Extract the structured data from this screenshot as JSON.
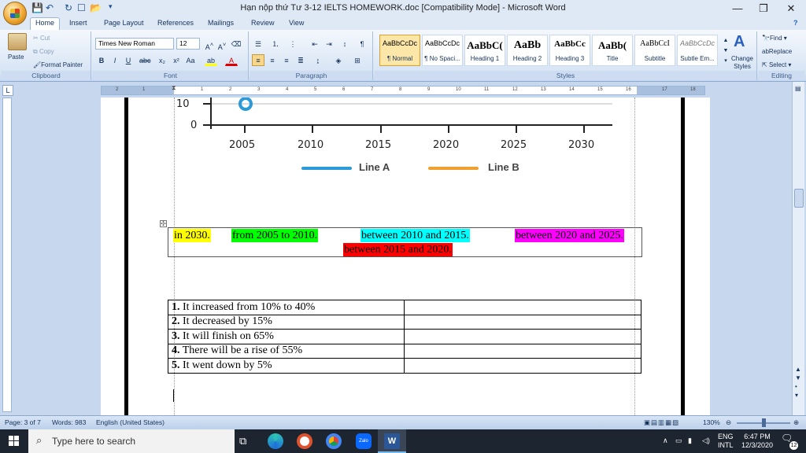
{
  "window": {
    "title": "Hạn nộp thứ Tư 3-12 IELTS HOMEWORK.doc [Compatibility Mode] - Microsoft Word",
    "minimize": "—",
    "restore": "❐",
    "close": "✕",
    "help": "?"
  },
  "tabs": [
    "Home",
    "Insert",
    "Page Layout",
    "References",
    "Mailings",
    "Review",
    "View"
  ],
  "ribbon": {
    "clipboard": {
      "label": "Clipboard",
      "paste": "Paste",
      "cut": "Cut",
      "copy": "Copy",
      "format_painter": "Format Painter"
    },
    "font": {
      "label": "Font",
      "name": "Times New Roman",
      "size": "12"
    },
    "paragraph": {
      "label": "Paragraph"
    },
    "styles": {
      "label": "Styles",
      "items": [
        {
          "sample": "AaBbCcDc",
          "name": "¶ Normal"
        },
        {
          "sample": "AaBbCcDc",
          "name": "¶ No Spaci..."
        },
        {
          "sample": "AaBbC(",
          "name": "Heading 1"
        },
        {
          "sample": "AaBb",
          "name": "Heading 2"
        },
        {
          "sample": "AaBbCc",
          "name": "Heading 3"
        },
        {
          "sample": "AaBb(",
          "name": "Title"
        },
        {
          "sample": "AaBbCcI",
          "name": "Subtitle"
        },
        {
          "sample": "AaBbCcDc",
          "name": "Subtle Em..."
        }
      ],
      "change_styles": "Change Styles"
    },
    "editing": {
      "label": "Editing",
      "find": "Find",
      "replace": "Replace",
      "select": "Select"
    }
  },
  "ruler": [
    "2",
    "1",
    "1",
    "2",
    "3",
    "4",
    "5",
    "6",
    "7",
    "8",
    "9",
    "10",
    "11",
    "12",
    "13",
    "14",
    "15",
    "16",
    "17",
    "18"
  ],
  "chart_data": {
    "type": "line",
    "x_ticks": [
      "2005",
      "2010",
      "2015",
      "2020",
      "2025",
      "2030"
    ],
    "y_ticks": [
      "10",
      "0"
    ],
    "series": [
      {
        "name": "Line A",
        "color": "#2a9ad8"
      },
      {
        "name": "Line B",
        "color": "#f0a030"
      }
    ]
  },
  "phrases": {
    "p1": {
      "text": "in 2030.",
      "color": "#ffff00"
    },
    "p2": {
      "text": "from 2005 to 2010.",
      "color": "#00ff00"
    },
    "p3": {
      "text": "between 2010 and 2015.",
      "color": "#00ffff"
    },
    "p4": {
      "text": "between 2020 and 2025.",
      "color": "#ff00ff"
    },
    "p5": {
      "text": "between 2015 and 2020.",
      "color": "#ff0000"
    }
  },
  "sentences": [
    {
      "num": "1.",
      "text": " It increased from 10% to 40%"
    },
    {
      "num": "2.",
      "text": " It decreased by 15%"
    },
    {
      "num": "3.",
      "text": " It will finish on 65%"
    },
    {
      "num": "4.",
      "text": " There will be a rise of 55%"
    },
    {
      "num": "5.",
      "text": " It went down by 5%"
    }
  ],
  "status": {
    "page": "Page: 3 of 7",
    "words": "Words: 983",
    "language": "English (United States)",
    "zoom": "130%"
  },
  "taskbar": {
    "search": "Type here to search",
    "lang1": "ENG",
    "lang2": "INTL",
    "time": "6:47 PM",
    "date": "12/3/2020",
    "notif": "12"
  }
}
